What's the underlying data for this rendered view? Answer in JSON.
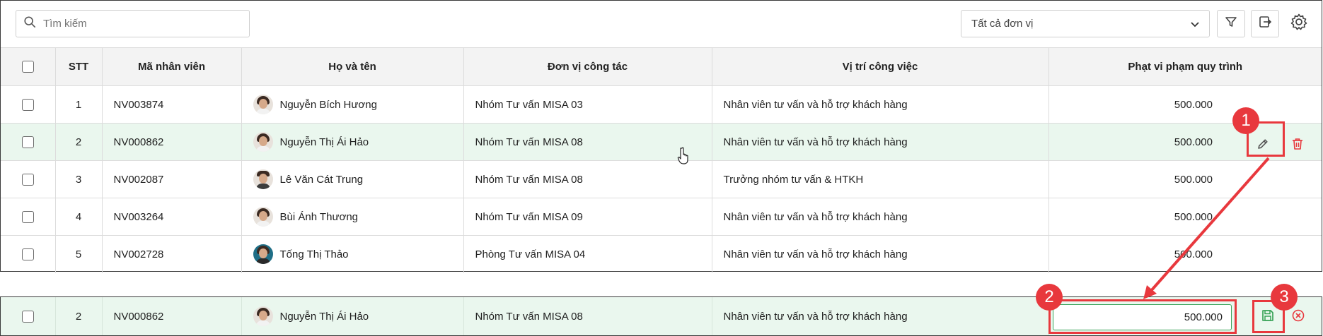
{
  "toolbar": {
    "search_placeholder": "Tìm kiếm",
    "unit_filter_value": "Tất cả đơn vị"
  },
  "table": {
    "headers": {
      "stt": "STT",
      "employee_code": "Mã nhân viên",
      "full_name": "Họ và tên",
      "unit": "Đơn vị công tác",
      "position": "Vị trí công việc",
      "penalty": "Phạt vi phạm quy trình"
    },
    "rows": [
      {
        "stt": "1",
        "code": "NV003874",
        "name": "Nguyễn Bích Hương",
        "unit": "Nhóm Tư vấn MISA 03",
        "position": "Nhân viên tư vấn và hỗ trợ khách hàng",
        "penalty": "500.000"
      },
      {
        "stt": "2",
        "code": "NV000862",
        "name": "Nguyễn Thị Ái Hảo",
        "unit": "Nhóm Tư vấn MISA 08",
        "position": "Nhân viên tư vấn và hỗ trợ khách hàng",
        "penalty": "500.000"
      },
      {
        "stt": "3",
        "code": "NV002087",
        "name": "Lê Văn Cát Trung",
        "unit": "Nhóm Tư vấn MISA 08",
        "position": "Trưởng nhóm tư vấn & HTKH",
        "penalty": "500.000"
      },
      {
        "stt": "4",
        "code": "NV003264",
        "name": "Bùi Ánh Thương",
        "unit": "Nhóm Tư vấn MISA 09",
        "position": "Nhân viên tư vấn và hỗ trợ khách hàng",
        "penalty": "500.000"
      },
      {
        "stt": "5",
        "code": "NV002728",
        "name": "Tống Thị Thảo",
        "unit": "Phòng Tư vấn MISA 04",
        "position": "Nhân viên tư vấn và hỗ trợ khách hàng",
        "penalty": "500.000"
      }
    ]
  },
  "edit_row": {
    "stt": "2",
    "code": "NV000862",
    "name": "Nguyễn Thị Ái Hảo",
    "unit": "Nhóm Tư vấn MISA 08",
    "position": "Nhân viên tư vấn và hỗ trợ khách hàng",
    "penalty_value": "500.000"
  },
  "callouts": {
    "step1": "1",
    "step2": "2",
    "step3": "3"
  },
  "colors": {
    "highlight_row": "#eaf7ee",
    "annotation_red": "#e8383d",
    "save_green": "#2e9e4f",
    "delete_red": "#e8383d"
  }
}
